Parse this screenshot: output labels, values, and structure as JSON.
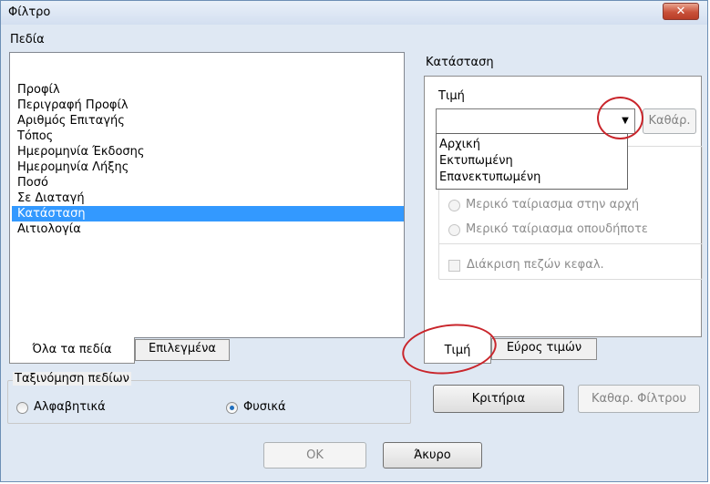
{
  "window": {
    "title": "Φίλτρο",
    "close_glyph": "✕"
  },
  "fields": {
    "label": "Πεδία",
    "items": [
      "Προφίλ",
      "Περιγραφή Προφίλ",
      "Αριθμός Επιταγής",
      "Τόπος",
      "Ημερομηνία Έκδοσης",
      "Ημερομηνία Λήξης",
      "Ποσό",
      "Σε Διαταγή",
      "Κατάσταση",
      "Αιτιολογία"
    ],
    "selected": "Κατάσταση",
    "tabs": [
      "Όλα τα πεδία",
      "Επιλεγμένα"
    ]
  },
  "sort": {
    "label": "Ταξινόμηση πεδίων",
    "options": [
      "Αλφαβητικά",
      "Φυσικά"
    ],
    "selected": "Φυσικά"
  },
  "criteria": {
    "label": "Κατάσταση",
    "value_label": "Τιμή",
    "value": "",
    "clear_button": "Καθάρ.",
    "dropdown_options": [
      "Αρχική",
      "Εκτυπωμένη",
      "Επανεκτυπωμένη"
    ],
    "match_options": [
      "Μερικό ταίριασμα στην αρχή",
      "Μερικό ταίριασμα οπουδήποτε"
    ],
    "case_sensitive_label": "Διάκριση πεζών κεφαλ.",
    "case_sensitive": false,
    "tabs": [
      "Τιμή",
      "Εύρος τιμών"
    ],
    "active_tab": "Τιμή"
  },
  "buttons": {
    "criteria": "Κριτήρια",
    "clear_filter": "Καθαρ. Φίλτρου",
    "ok": "OK",
    "cancel": "Άκυρο"
  },
  "colors": {
    "selection": "#3399ff",
    "callout": "#c9252b"
  }
}
